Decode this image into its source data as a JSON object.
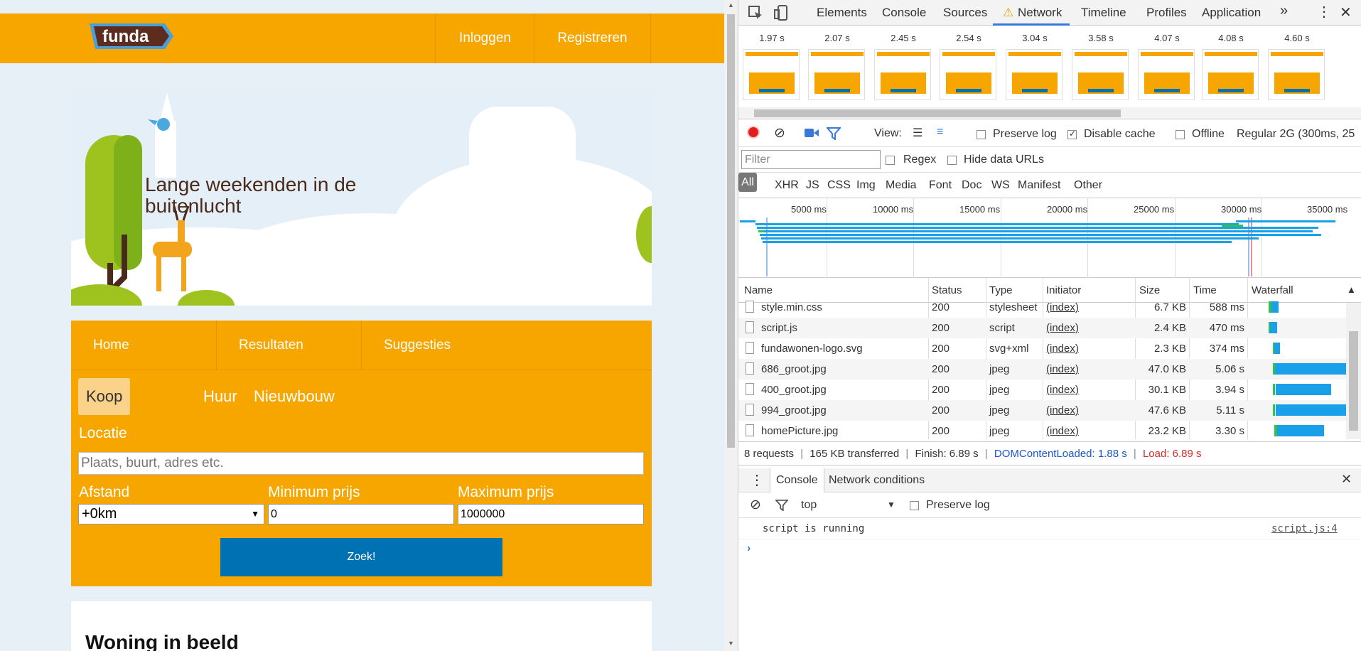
{
  "site": {
    "logo_text": "funda",
    "nav": {
      "login": "Inloggen",
      "register": "Registreren"
    },
    "hero_title": "Lange weekenden in de buitenlucht",
    "tabs": [
      "Home",
      "Resultaten",
      "Suggesties"
    ],
    "modes": [
      "Koop",
      "Huur",
      "Nieuwbouw"
    ],
    "search": {
      "location_label": "Locatie",
      "location_placeholder": "Plaats, buurt, adres etc.",
      "distance_label": "Afstand",
      "distance_value": "+0km",
      "min_label": "Minimum prijs",
      "min_value": "0",
      "max_label": "Maximum prijs",
      "max_value": "1000000",
      "submit": "Zoek!"
    },
    "section_title": "Woning in beeld",
    "colors": {
      "brand": "#f7a600",
      "button": "#0071b3"
    }
  },
  "devtools": {
    "tabs": [
      "Elements",
      "Console",
      "Sources",
      "Network",
      "Timeline",
      "Profiles",
      "Application"
    ],
    "more": "»",
    "active_tab": "Network",
    "filmstrip": [
      "1.97 s",
      "2.07 s",
      "2.45 s",
      "2.54 s",
      "3.04 s",
      "3.58 s",
      "4.07 s",
      "4.08 s",
      "4.60 s"
    ],
    "toolbar": {
      "view_label": "View:",
      "preserve_log": "Preserve log",
      "disable_cache": "Disable cache",
      "offline": "Offline",
      "throttle": "Regular 2G (300ms, 25"
    },
    "filter": {
      "placeholder": "Filter",
      "regex": "Regex",
      "hide_data": "Hide data URLs"
    },
    "types": [
      "All",
      "XHR",
      "JS",
      "CSS",
      "Img",
      "Media",
      "Font",
      "Doc",
      "WS",
      "Manifest",
      "Other"
    ],
    "overview_ticks": [
      "5000 ms",
      "10000 ms",
      "15000 ms",
      "20000 ms",
      "25000 ms",
      "30000 ms",
      "35000 ms"
    ],
    "columns": [
      "Name",
      "Status",
      "Type",
      "Initiator",
      "Size",
      "Time",
      "Waterfall"
    ],
    "rows": [
      {
        "name": "style.min.css",
        "status": "200",
        "type": "stylesheet",
        "initiator": "(index)",
        "size": "6.7 KB",
        "time": "588 ms"
      },
      {
        "name": "script.js",
        "status": "200",
        "type": "script",
        "initiator": "(index)",
        "size": "2.4 KB",
        "time": "470 ms"
      },
      {
        "name": "fundawonen-logo.svg",
        "status": "200",
        "type": "svg+xml",
        "initiator": "(index)",
        "size": "2.3 KB",
        "time": "374 ms"
      },
      {
        "name": "686_groot.jpg",
        "status": "200",
        "type": "jpeg",
        "initiator": "(index)",
        "size": "47.0 KB",
        "time": "5.06 s"
      },
      {
        "name": "400_groot.jpg",
        "status": "200",
        "type": "jpeg",
        "initiator": "(index)",
        "size": "30.1 KB",
        "time": "3.94 s"
      },
      {
        "name": "994_groot.jpg",
        "status": "200",
        "type": "jpeg",
        "initiator": "(index)",
        "size": "47.6 KB",
        "time": "5.11 s"
      },
      {
        "name": "homePicture.jpg",
        "status": "200",
        "type": "jpeg",
        "initiator": "(index)",
        "size": "23.2 KB",
        "time": "3.30 s"
      }
    ],
    "summary": {
      "requests": "8 requests",
      "transferred": "165 KB transferred",
      "finish": "Finish: 6.89 s",
      "dcl": "DOMContentLoaded: 1.88 s",
      "load": "Load: 6.89 s",
      "sep": "|"
    },
    "drawer": {
      "tabs": [
        "Console",
        "Network conditions"
      ],
      "context": "top",
      "preserve_log": "Preserve log",
      "message": "script is running",
      "source": "script.js:4",
      "prompt": "›"
    }
  }
}
